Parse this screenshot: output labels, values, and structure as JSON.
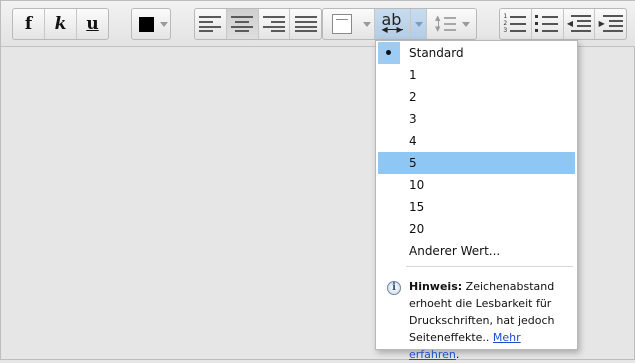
{
  "toolbar": {
    "bold_label": "f",
    "italic_label": "k",
    "underline_label": "u",
    "font_color": "#000000",
    "spacing_label": "ab"
  },
  "menu": {
    "items": [
      {
        "label": "Standard",
        "checked": true
      },
      {
        "label": "1"
      },
      {
        "label": "2"
      },
      {
        "label": "3"
      },
      {
        "label": "4"
      },
      {
        "label": "5",
        "highlighted": true
      },
      {
        "label": "10"
      },
      {
        "label": "15"
      },
      {
        "label": "20"
      },
      {
        "label": "Anderer Wert..."
      }
    ],
    "note": {
      "title": "Hinweis:",
      "text": "Zeichenabstand erhoeht die Lesbarkeit für Druckschriften, hat jedoch Seiteneffekte.. ",
      "link": "Mehr erfahren",
      "suffix": "."
    }
  }
}
